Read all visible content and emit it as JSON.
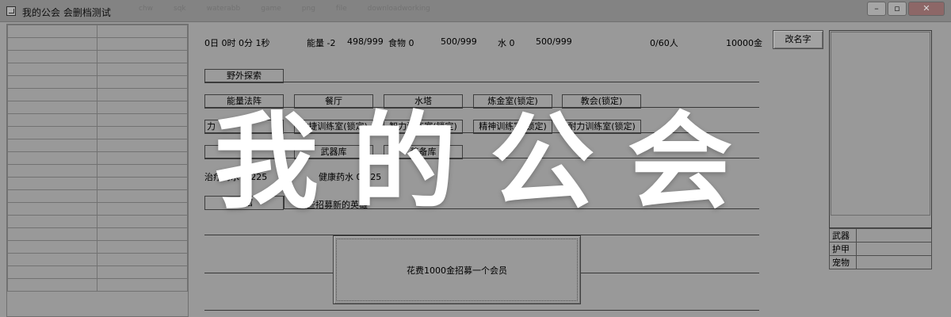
{
  "window": {
    "title": "我的公会 会删档测试",
    "ghost_tabs": [
      "chw",
      "sqk",
      "waterabb",
      "game",
      "png",
      "file",
      "downloadworking"
    ],
    "minimize": "–",
    "maximize": "▫",
    "close": "✕"
  },
  "status": {
    "time": "0日 0时 0分 1秒",
    "energy_label": "能量 -2",
    "energy_value": "498/999",
    "food_label": "食物 0",
    "food_value": "500/999",
    "water_label": "水 0",
    "water_value": "500/999",
    "members": "0/60人",
    "gold": "10000金"
  },
  "buttons": {
    "rename": "改名字",
    "explore": "野外探索",
    "energy_array": "能量法阵",
    "restaurant": "餐厅",
    "water_tower": "水塔",
    "alchemy": "炼金室(锁定)",
    "church": "教会(锁定)",
    "strength": "力",
    "agility": "敏捷训练室(锁定)",
    "intellect": "智力训练室(锁定)",
    "spirit": "精神训练室(锁定)",
    "stamina": "耐力训练室(锁定)",
    "armory": "武器库",
    "equipment": "装备库",
    "tavern": "酒馆",
    "recruit": "花费1000金招募一个会员"
  },
  "labels": {
    "heal_potion": "治疗药水 0/225",
    "health_potion": "健康药水 0/225",
    "recruiting_heroes": "在些招募新的英雄"
  },
  "equipment_slots": [
    "武器",
    "护甲",
    "宠物"
  ],
  "overlay_title": "我的公会"
}
